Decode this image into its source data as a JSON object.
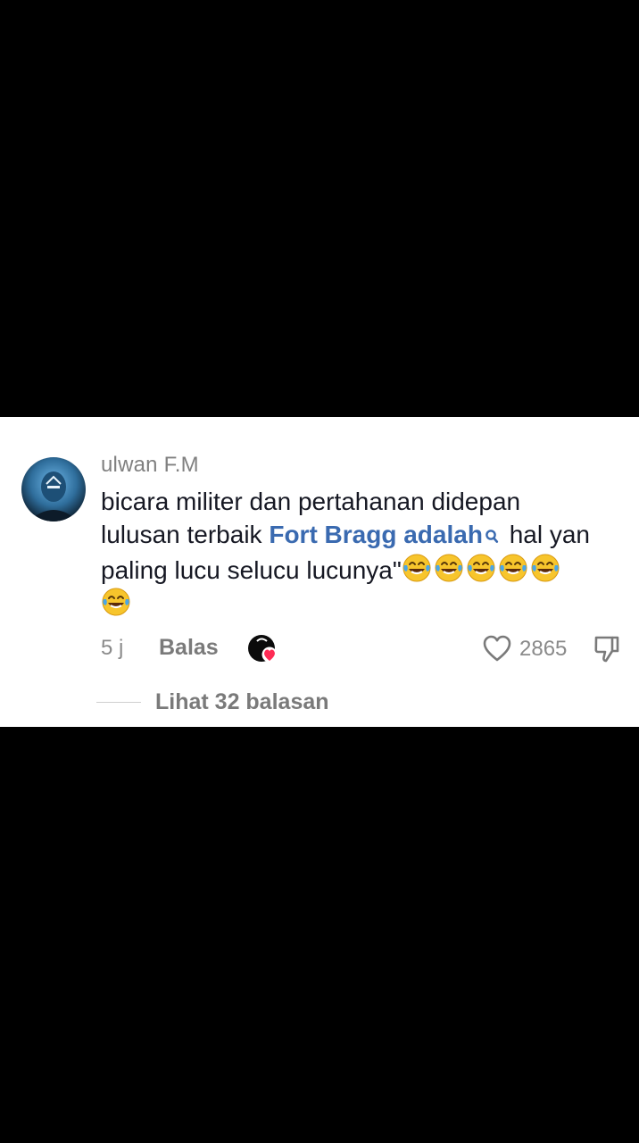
{
  "comment": {
    "username": "ulwan F.M",
    "line1": "bicara militer dan pertahanan didepan",
    "line2_before": "lulusan terbaik ",
    "line2_link": "Fort Bragg adalah",
    "line2_after": " hal yan",
    "line3": "paling lucu selucu lucunya\"",
    "emoji_name": "face-with-tears-of-joy",
    "emoji_count": 6,
    "timestamp": "5 j",
    "reply_label": "Balas",
    "like_count": "2865",
    "view_replies_label": "Lihat 32 balasan"
  },
  "colors": {
    "link": "#3a6ab0",
    "text": "#161823",
    "muted": "#8a8a8a",
    "heart": "#fe2c55"
  }
}
